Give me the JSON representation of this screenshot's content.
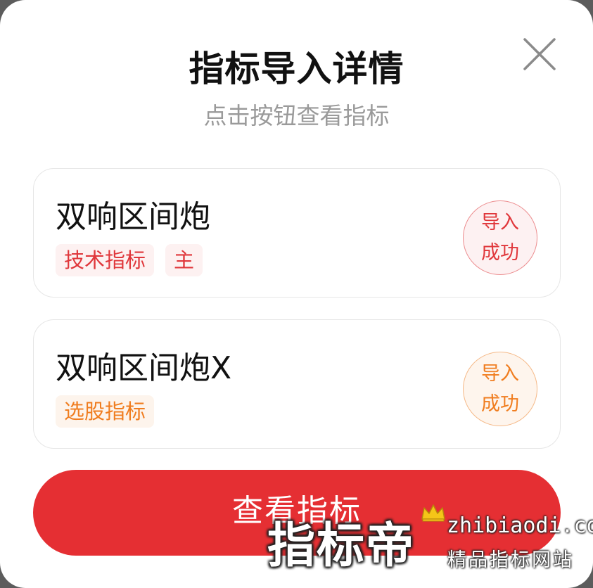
{
  "dialog": {
    "title": "指标导入详情",
    "subtitle": "点击按钮查看指标",
    "close_icon": "close-icon"
  },
  "indicators": [
    {
      "name": "双响区间炮",
      "tags": [
        "技术指标",
        "主"
      ],
      "status_line1": "导入",
      "status_line2": "成功",
      "color": "#e0373b"
    },
    {
      "name": "双响区间炮X",
      "tags": [
        "选股指标"
      ],
      "status_line1": "导入",
      "status_line2": "成功",
      "color": "#f07d1f"
    }
  ],
  "primary_button": {
    "label": "查看指标",
    "color": "#e52f33"
  },
  "watermark": {
    "brand": "指标帝",
    "url": "zhibiaodi.com",
    "slogan": "精品指标网站"
  }
}
